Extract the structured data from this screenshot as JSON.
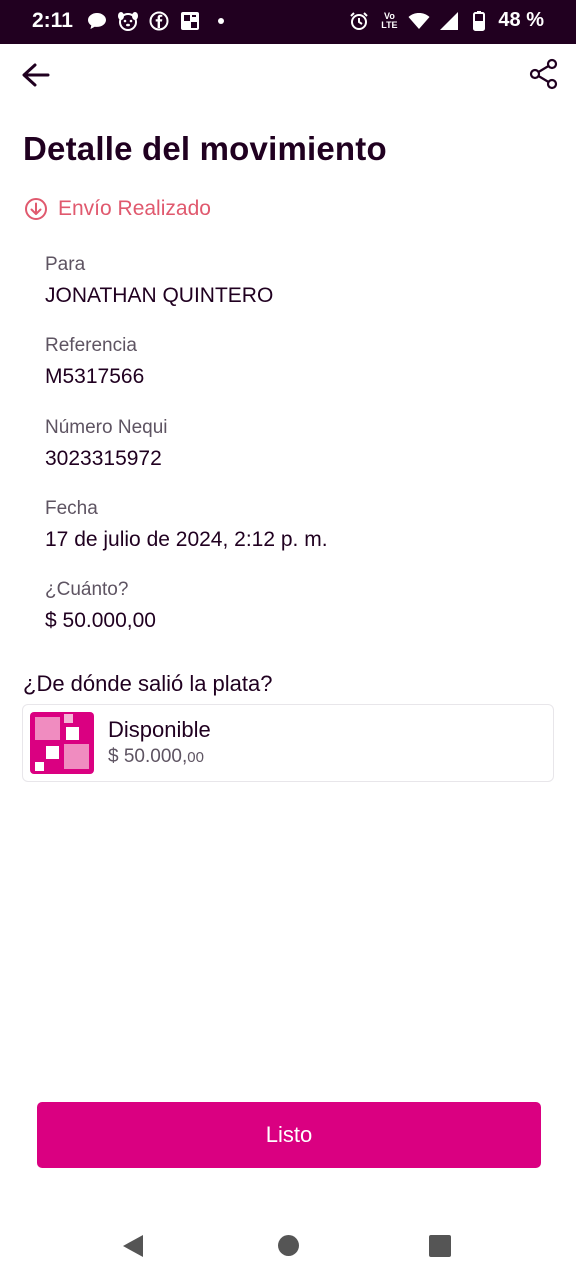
{
  "status_bar": {
    "time": "2:11",
    "volte_top": "Vo",
    "volte_bottom": "LTE",
    "battery_percent": "48 %",
    "icons": [
      "chat-bubble-icon",
      "dog-icon",
      "facebook-icon",
      "news-icon",
      "dot-icon",
      "alarm-icon",
      "volte-icon",
      "wifi-icon",
      "signal-icon",
      "battery-icon"
    ]
  },
  "header": {
    "back_icon": "back-arrow-icon",
    "share_icon": "share-icon"
  },
  "page": {
    "title": "Detalle del movimiento",
    "status_label": "Envío Realizado",
    "status_color": "#e0596e"
  },
  "details": {
    "recipient_label": "Para",
    "recipient_value": "JONATHAN QUINTERO",
    "reference_label": "Referencia",
    "reference_value": "M5317566",
    "nequi_number_label": "Número Nequi",
    "nequi_number_value": "3023315972",
    "date_label": "Fecha",
    "date_value": "17 de julio de 2024, 2:12 p. m.",
    "amount_label": "¿Cuánto?",
    "amount_value": "$ 50.000,00"
  },
  "source": {
    "title": "¿De dónde salió la plata?",
    "pocket_name": "Disponible",
    "pocket_amount_main": "$ 50.000,",
    "pocket_amount_cents": "00"
  },
  "actions": {
    "done_label": "Listo"
  },
  "colors": {
    "brand": "#da0081",
    "dark": "#210020"
  }
}
